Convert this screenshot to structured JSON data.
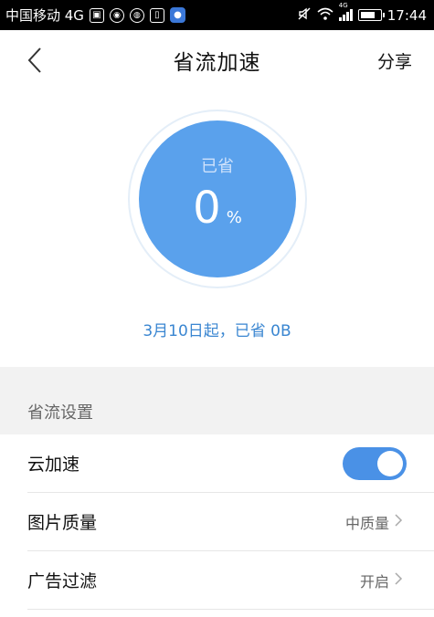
{
  "status_bar": {
    "carrier": "中国移动 4G",
    "time": "17:44",
    "signal_label": "4G"
  },
  "nav": {
    "title": "省流加速",
    "share_label": "分享"
  },
  "gauge": {
    "label": "已省",
    "value": "0",
    "unit": "%",
    "percent": 0
  },
  "saved_since": "3月10日起，已省 0B",
  "settings": {
    "section_title": "省流设置",
    "rows": [
      {
        "label": "云加速",
        "type": "toggle",
        "on": true
      },
      {
        "label": "图片质量",
        "value": "中质量"
      },
      {
        "label": "广告过滤",
        "value": "开启"
      }
    ]
  },
  "colors": {
    "accent": "#5aa1ec",
    "toggle_on": "#4a91e6",
    "link_text": "#3a86d1"
  }
}
